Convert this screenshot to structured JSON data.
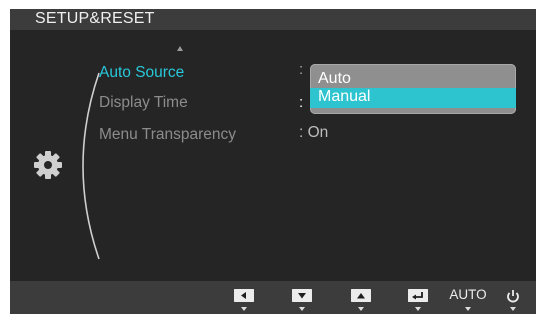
{
  "header": {
    "title": "SETUP&RESET"
  },
  "menu": {
    "items": [
      {
        "label": "Auto Source"
      },
      {
        "label": "Display Time"
      },
      {
        "label": "Menu Transparency"
      }
    ],
    "colon": ":",
    "transparency_value": ": On"
  },
  "dropdown": {
    "options": [
      "Auto",
      "Manual"
    ],
    "selected": "Manual"
  },
  "bottombar": {
    "auto_label": "AUTO",
    "buttons": [
      "left-icon",
      "down-icon",
      "up-icon",
      "enter-icon",
      "auto",
      "power-icon"
    ]
  },
  "colors": {
    "accent": "#28c7d9",
    "selection": "#2ec4cf",
    "panel": "#252525",
    "bar": "#3c3c3c"
  }
}
